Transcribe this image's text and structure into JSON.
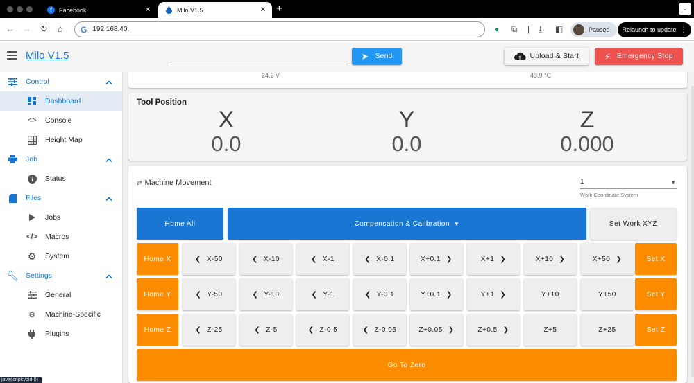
{
  "browser": {
    "tabs": [
      {
        "title": "Facebook",
        "active": false,
        "favicon": "facebook-icon"
      },
      {
        "title": "Milo V1.5",
        "active": true,
        "favicon": "droplet-icon"
      }
    ],
    "url": "192.168.40.",
    "profile_status": "Paused",
    "relaunch_label": "Relaunch to update",
    "status_bar": "javascript:void(0)"
  },
  "appbar": {
    "title": "Milo V1.5",
    "gcode_placeholder": "",
    "send_label": "Send",
    "upload_label": "Upload & Start",
    "estop_label": "Emergency Stop",
    "colors": {
      "send": "#2196f3",
      "estop": "#ef5350",
      "primary": "#1976d2",
      "orange": "#fb8c00"
    }
  },
  "sidebar": {
    "groups": [
      {
        "label": "Control",
        "icon": "sliders-icon",
        "items": [
          {
            "label": "Dashboard",
            "icon": "dashboard-icon",
            "active": true
          },
          {
            "label": "Console",
            "icon": "code-icon"
          },
          {
            "label": "Height Map",
            "icon": "grid-icon"
          }
        ]
      },
      {
        "label": "Job",
        "icon": "printer-icon",
        "items": [
          {
            "label": "Status",
            "icon": "info-icon"
          }
        ]
      },
      {
        "label": "Files",
        "icon": "sd-card-icon",
        "items": [
          {
            "label": "Jobs",
            "icon": "play-icon"
          },
          {
            "label": "Macros",
            "icon": "macro-code-icon"
          },
          {
            "label": "System",
            "icon": "gear-icon"
          }
        ]
      },
      {
        "label": "Settings",
        "icon": "wrench-icon",
        "items": [
          {
            "label": "General",
            "icon": "sliders-icon"
          },
          {
            "label": "Machine-Specific",
            "icon": "cogs-icon"
          },
          {
            "label": "Plugins",
            "icon": "plug-icon"
          }
        ]
      }
    ]
  },
  "status_card": {
    "voltage": "24.2 V",
    "temperature": "43.9 °C"
  },
  "tool_position": {
    "heading": "Tool Position",
    "axes": [
      {
        "label": "X",
        "value": "0.0"
      },
      {
        "label": "Y",
        "value": "0.0"
      },
      {
        "label": "Z",
        "value": "0.000"
      }
    ]
  },
  "machine_movement": {
    "heading": "Machine Movement",
    "wcs_value": "1",
    "wcs_label": "Work Coordinate System",
    "home_all": "Home All",
    "compensation": "Compensation & Calibration",
    "set_work": "Set Work XYZ",
    "rows": [
      {
        "home": "Home X",
        "set": "Set X",
        "jogs": [
          "X-50",
          "X-10",
          "X-1",
          "X-0.1",
          "X+0.1",
          "X+1",
          "X+10",
          "X+50"
        ]
      },
      {
        "home": "Home Y",
        "set": "Set Y",
        "jogs": [
          "Y-50",
          "Y-10",
          "Y-1",
          "Y-0.1",
          "Y+0.1",
          "Y+1",
          "Y+10",
          "Y+50"
        ]
      },
      {
        "home": "Home Z",
        "set": "Set Z",
        "jogs": [
          "Z-25",
          "Z-5",
          "Z-0.5",
          "Z-0.05",
          "Z+0.05",
          "Z+0.5",
          "Z+5",
          "Z+25"
        ]
      }
    ],
    "go_to_zero": "Go To Zero"
  }
}
